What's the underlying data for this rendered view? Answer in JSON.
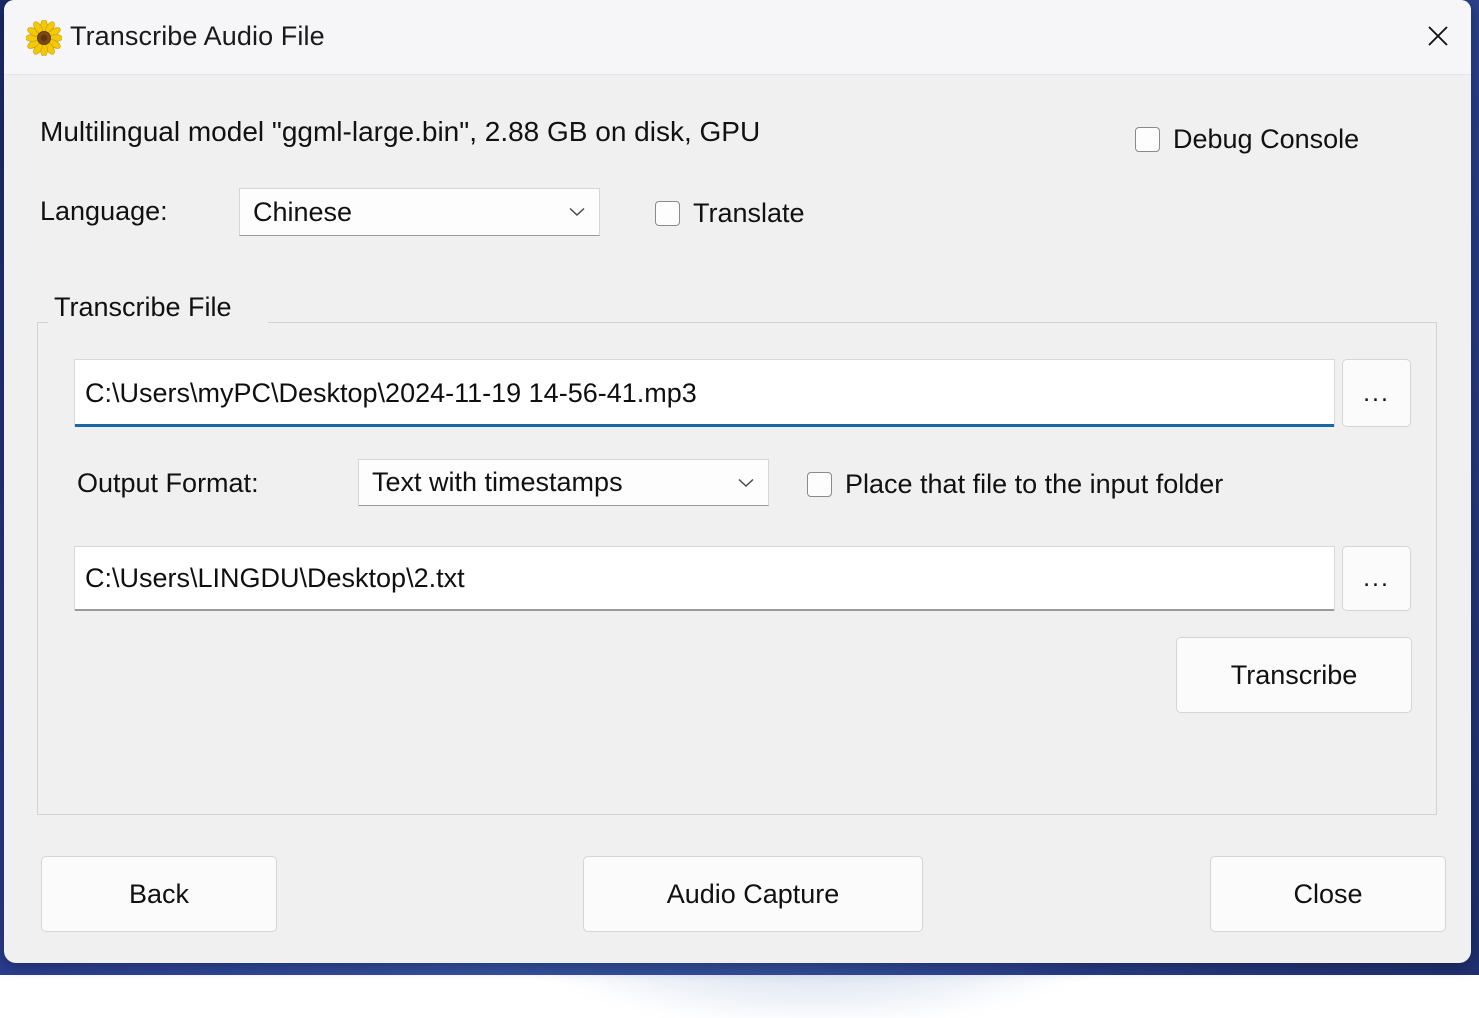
{
  "window": {
    "title": "Transcribe Audio File",
    "icon": "sunflower-icon",
    "close_icon": "close-icon"
  },
  "header": {
    "model_info": "Multilingual model \"ggml-large.bin\", 2.88 GB on disk, GPU",
    "debug_console": {
      "label": "Debug Console",
      "checked": false
    }
  },
  "language_row": {
    "label": "Language:",
    "selected": "Chinese",
    "options": [
      "Chinese"
    ],
    "translate": {
      "label": "Translate",
      "checked": false
    }
  },
  "transcribe_file_group": {
    "title": "Transcribe File",
    "input_path": "C:\\Users\\myPC\\Desktop\\2024-11-19 14-56-41.mp3",
    "input_browse_label": "...",
    "output_format": {
      "label": "Output Format:",
      "selected": "Text with timestamps",
      "options": [
        "Text with timestamps"
      ]
    },
    "place_file": {
      "label": "Place that file to the input folder",
      "checked": false
    },
    "output_path": "C:\\Users\\LINGDU\\Desktop\\2.txt",
    "output_browse_label": "...",
    "transcribe_label": "Transcribe"
  },
  "footer": {
    "back_label": "Back",
    "audio_capture_label": "Audio Capture",
    "close_label": "Close"
  },
  "colors": {
    "window_background": "#f0f0f0",
    "titlebar_background": "#f6f6f9",
    "accent_focus_underline": "#1668a8",
    "desktop_background": "#2a3d8f",
    "text": "#111111"
  }
}
